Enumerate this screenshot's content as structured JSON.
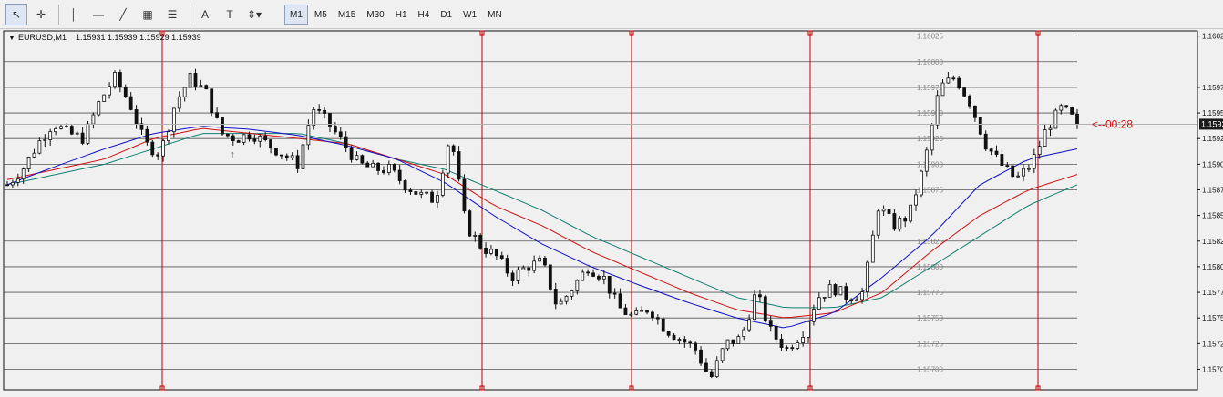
{
  "toolbar": {
    "tools": [
      {
        "name": "cursor-tool",
        "glyph": "↖",
        "active": true
      },
      {
        "name": "crosshair-tool",
        "glyph": "✛",
        "active": false
      },
      {
        "name": "vertical-line-tool",
        "glyph": "│",
        "active": false
      },
      {
        "name": "horizontal-line-tool",
        "glyph": "—",
        "active": false
      },
      {
        "name": "trendline-tool",
        "glyph": "╱",
        "active": false
      },
      {
        "name": "equidistant-channel-tool",
        "glyph": "▦",
        "active": false
      },
      {
        "name": "fibonacci-tool",
        "glyph": "☰",
        "active": false
      },
      {
        "name": "text-tool",
        "glyph": "A",
        "active": false
      },
      {
        "name": "text-label-tool",
        "glyph": "T",
        "active": false
      },
      {
        "name": "arrows-tool",
        "glyph": "⇕▾",
        "active": false
      }
    ],
    "timeframes": [
      "M1",
      "M5",
      "M15",
      "M30",
      "H1",
      "H4",
      "D1",
      "W1",
      "MN"
    ],
    "active_timeframe": "M1"
  },
  "chart_header": {
    "symbol": "EURUSD,M1",
    "ohlc": "1.15931 1.15939 1.15929 1.15939"
  },
  "countdown": "<--00:28",
  "colors": {
    "candle": "#111111",
    "ma_fast": "#1010c8",
    "ma_mid": "#d01010",
    "ma_slow": "#108070",
    "vline": "#c00000",
    "arrow_down": "#e01010",
    "arrow_up": "#109010",
    "grid": "#555555"
  },
  "chart_data": {
    "type": "candlestick",
    "ylim": [
      1.1568,
      1.1603
    ],
    "axis_ticks": [
      "1.16025",
      "1.15975",
      "1.15950",
      "1.15925",
      "1.15900",
      "1.15875",
      "1.15850",
      "1.15825",
      "1.15800",
      "1.15775",
      "1.15750",
      "1.15725",
      "1.15700"
    ],
    "inner_labels": [
      "1.16025",
      "1.16000",
      "1.15975",
      "1.15950",
      "1.15925",
      "1.15900",
      "1.15875",
      "1.15825",
      "1.15800",
      "1.15775",
      "1.15750",
      "1.15725",
      "1.15700"
    ],
    "current_price_label": "1.15939",
    "current_price": 1.15939,
    "close_path": [
      1.1588,
      1.15895,
      1.1592,
      1.1594,
      1.1593,
      1.15925,
      1.1596,
      1.15985,
      1.1596,
      1.1592,
      1.1591,
      1.1596,
      1.15985,
      1.1597,
      1.1593,
      1.15925,
      1.1593,
      1.1592,
      1.1591,
      1.159,
      1.15955,
      1.1594,
      1.1592,
      1.159,
      1.15895,
      1.15895,
      1.1588,
      1.1587,
      1.15865,
      1.1593,
      1.1584,
      1.1582,
      1.1581,
      1.1579,
      1.158,
      1.15805,
      1.1576,
      1.1578,
      1.158,
      1.1579,
      1.1576,
      1.1575,
      1.1576,
      1.1574,
      1.1573,
      1.1572,
      1.1569,
      1.15725,
      1.1573,
      1.15775,
      1.15735,
      1.1572,
      1.15735,
      1.1577,
      1.1578,
      1.1577,
      1.15775,
      1.1586,
      1.1584,
      1.1585,
      1.159,
      1.15975,
      1.15985,
      1.1596,
      1.1592,
      1.159,
      1.15885,
      1.159,
      1.15935,
      1.15955,
      1.1594
    ],
    "ma_fast": [
      1.1588,
      1.15898,
      1.15915,
      1.1593,
      1.15937,
      1.15934,
      1.15928,
      1.15918,
      1.15905,
      1.15882,
      1.1585,
      1.15822,
      1.158,
      1.15782,
      1.15765,
      1.1575,
      1.1574,
      1.15755,
      1.1579,
      1.1583,
      1.1588,
      1.15905,
      1.15915
    ],
    "ma_mid": [
      1.15885,
      1.15895,
      1.15905,
      1.15925,
      1.15935,
      1.1593,
      1.15925,
      1.1592,
      1.15905,
      1.1589,
      1.1586,
      1.1584,
      1.15815,
      1.15795,
      1.15775,
      1.15758,
      1.1575,
      1.15755,
      1.15775,
      1.15815,
      1.1585,
      1.15875,
      1.1589
    ],
    "ma_slow": [
      1.1588,
      1.1589,
      1.159,
      1.15915,
      1.1593,
      1.1593,
      1.1593,
      1.1592,
      1.15905,
      1.15895,
      1.15875,
      1.15855,
      1.1583,
      1.1581,
      1.1579,
      1.1577,
      1.1576,
      1.1576,
      1.1577,
      1.158,
      1.1583,
      1.1586,
      1.1588
    ]
  }
}
